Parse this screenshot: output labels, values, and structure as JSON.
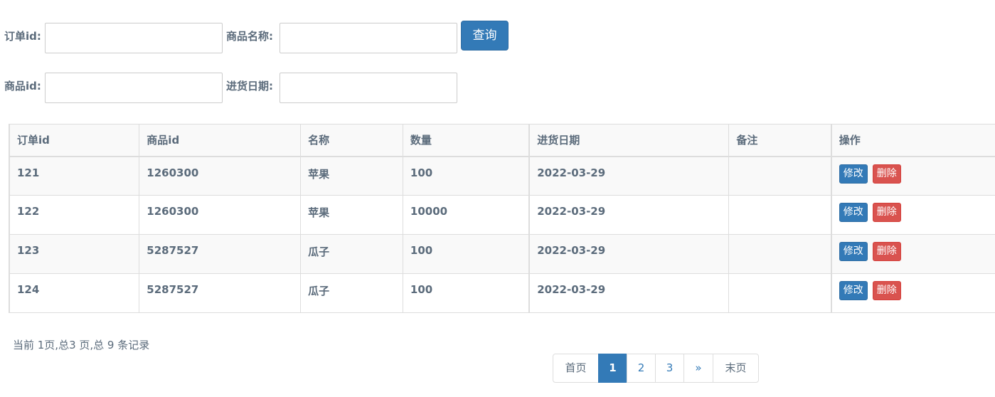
{
  "search": {
    "order_id_label": "订单id:",
    "order_id_value": "",
    "product_name_label": "商品名称:",
    "product_name_value": "",
    "query_button": "查询",
    "product_id_label": "商品id:",
    "product_id_value": "",
    "stock_date_label": "进货日期:",
    "stock_date_value": ""
  },
  "table": {
    "headers": [
      "订单id",
      "商品id",
      "名称",
      "数量",
      "进货日期",
      "备注",
      "操作"
    ],
    "rows": [
      {
        "order_id": "121",
        "product_id": "1260300",
        "name": "苹果",
        "qty": "100",
        "date": "2022-03-29",
        "note": ""
      },
      {
        "order_id": "122",
        "product_id": "1260300",
        "name": "苹果",
        "qty": "10000",
        "date": "2022-03-29",
        "note": ""
      },
      {
        "order_id": "123",
        "product_id": "5287527",
        "name": "瓜子",
        "qty": "100",
        "date": "2022-03-29",
        "note": ""
      },
      {
        "order_id": "124",
        "product_id": "5287527",
        "name": "瓜子",
        "qty": "100",
        "date": "2022-03-29",
        "note": ""
      }
    ],
    "edit_label": "修改",
    "delete_label": "删除"
  },
  "footer": {
    "summary": "当前 1页,总3 页,总 9 条记录",
    "pager": {
      "first": "首页",
      "pages": [
        "1",
        "2",
        "3"
      ],
      "next": "»",
      "last": "末页",
      "current": "1"
    }
  },
  "colors": {
    "primary": "#337ab7",
    "danger": "#d9534f",
    "text": "#5b6b7b",
    "border": "#dddddd",
    "row_bg": "#f9f9f9"
  }
}
